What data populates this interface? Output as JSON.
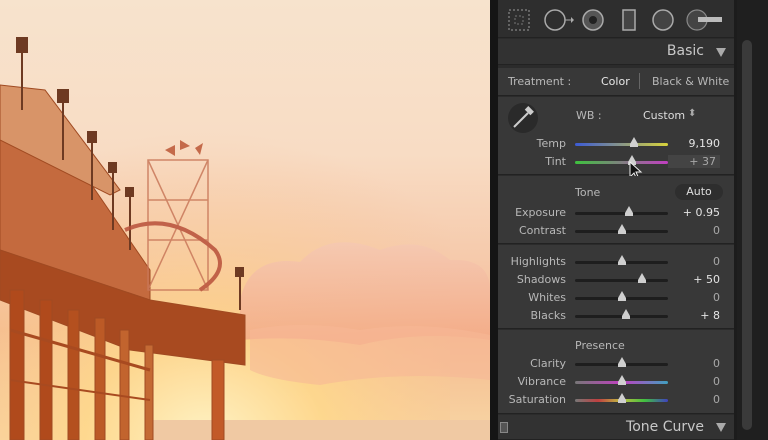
{
  "toolbar": {
    "icons": [
      "crop-grid-icon",
      "spot-removal-icon",
      "redeye-icon",
      "graduated-filter-icon",
      "radial-filter-icon",
      "adjustment-brush-icon"
    ]
  },
  "basic_panel": {
    "title": "Basic",
    "treatment_label": "Treatment :",
    "treatment_color": "Color",
    "treatment_bw": "Black & White",
    "wb_label": "WB :",
    "wb_value": "Custom",
    "wb_arrows": "⬍",
    "temp": {
      "label": "Temp",
      "value": "9,190",
      "level": 0.62
    },
    "tint": {
      "label": "Tint",
      "value": "+ 37",
      "level": 0.6
    },
    "tone_label": "Tone",
    "auto_label": "Auto",
    "exposure": {
      "label": "Exposure",
      "value": "+ 0.95",
      "level": 0.58
    },
    "contrast": {
      "label": "Contrast",
      "value": "0",
      "level": 0.5
    },
    "highlights": {
      "label": "Highlights",
      "value": "0",
      "level": 0.5
    },
    "shadows": {
      "label": "Shadows",
      "value": "+ 50",
      "level": 0.72
    },
    "whites": {
      "label": "Whites",
      "value": "0",
      "level": 0.5
    },
    "blacks": {
      "label": "Blacks",
      "value": "+ 8",
      "level": 0.54
    },
    "presence_label": "Presence",
    "clarity": {
      "label": "Clarity",
      "value": "0",
      "level": 0.5
    },
    "vibrance": {
      "label": "Vibrance",
      "value": "0",
      "level": 0.5
    },
    "saturation": {
      "label": "Saturation",
      "value": "0",
      "level": 0.5
    }
  },
  "tone_curve_panel": {
    "title": "Tone Curve"
  },
  "colors": {
    "panel_bg": "#383838",
    "temp_gradient": [
      "#3b5bd6",
      "#d8d33a"
    ],
    "tint_gradient": [
      "#3ec23e",
      "#c23ec2"
    ]
  }
}
